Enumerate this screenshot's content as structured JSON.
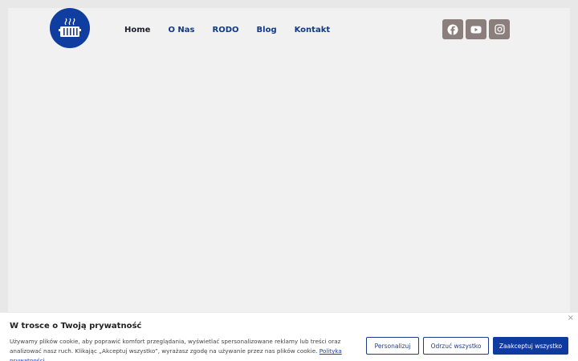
{
  "nav": {
    "items": [
      {
        "label": "Home",
        "active": true
      },
      {
        "label": "O Nas"
      },
      {
        "label": "RODO"
      },
      {
        "label": "Blog"
      },
      {
        "label": "Kontakt"
      }
    ]
  },
  "social": {
    "icons": [
      "facebook-icon",
      "youtube-icon",
      "instagram-icon"
    ]
  },
  "colors": {
    "brand_blue": "#0f3da0",
    "social_bg": "#8a7f7d",
    "page_bg": "#f1f1f1"
  },
  "cookie": {
    "close_label": "×",
    "title": "W trosce o Twoją prywatność",
    "text_main": "Używamy plików cookie, aby poprawić komfort przeglądania, wyświetlać spersonalizowane reklamy lub treści oraz analizować nasz ruch. Klikając „Akceptuj wszystko”, wyrażasz zgodę na używanie przez nas plików cookie. ",
    "policy_link": "Polityka prywatności",
    "buttons": {
      "customize": "Personalizuj",
      "reject": "Odrzuć wszystko",
      "accept": "Zaakceptuj wszystko"
    }
  }
}
